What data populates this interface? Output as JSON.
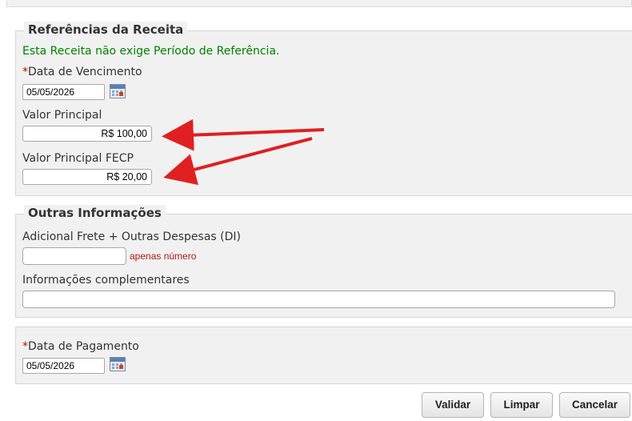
{
  "receita": {
    "legend": "Referências da Receita",
    "info": "Esta Receita não exige Período de Referência.",
    "required_mark": "*",
    "vencimento_label": "Data de Vencimento",
    "vencimento_value": "05/05/2026",
    "valor_principal_label": "Valor Principal",
    "valor_principal_value": "R$ 100,00",
    "valor_fecp_label": "Valor Principal FECP",
    "valor_fecp_value": "R$ 20,00"
  },
  "outras": {
    "legend": "Outras Informações",
    "adicional_label": "Adicional Frete + Outras Despesas (DI)",
    "adicional_value": "",
    "adicional_hint": "apenas número",
    "complementares_label": "Informações complementares",
    "complementares_value": ""
  },
  "pagamento": {
    "required_mark": "*",
    "label": "Data de Pagamento",
    "value": "05/05/2026"
  },
  "buttons": {
    "validar": "Validar",
    "limpar": "Limpar",
    "cancelar": "Cancelar"
  },
  "colors": {
    "info_green": "#008000",
    "required_red": "#cc0000",
    "hint_red": "#b01818",
    "arrow_red": "#e02020"
  }
}
